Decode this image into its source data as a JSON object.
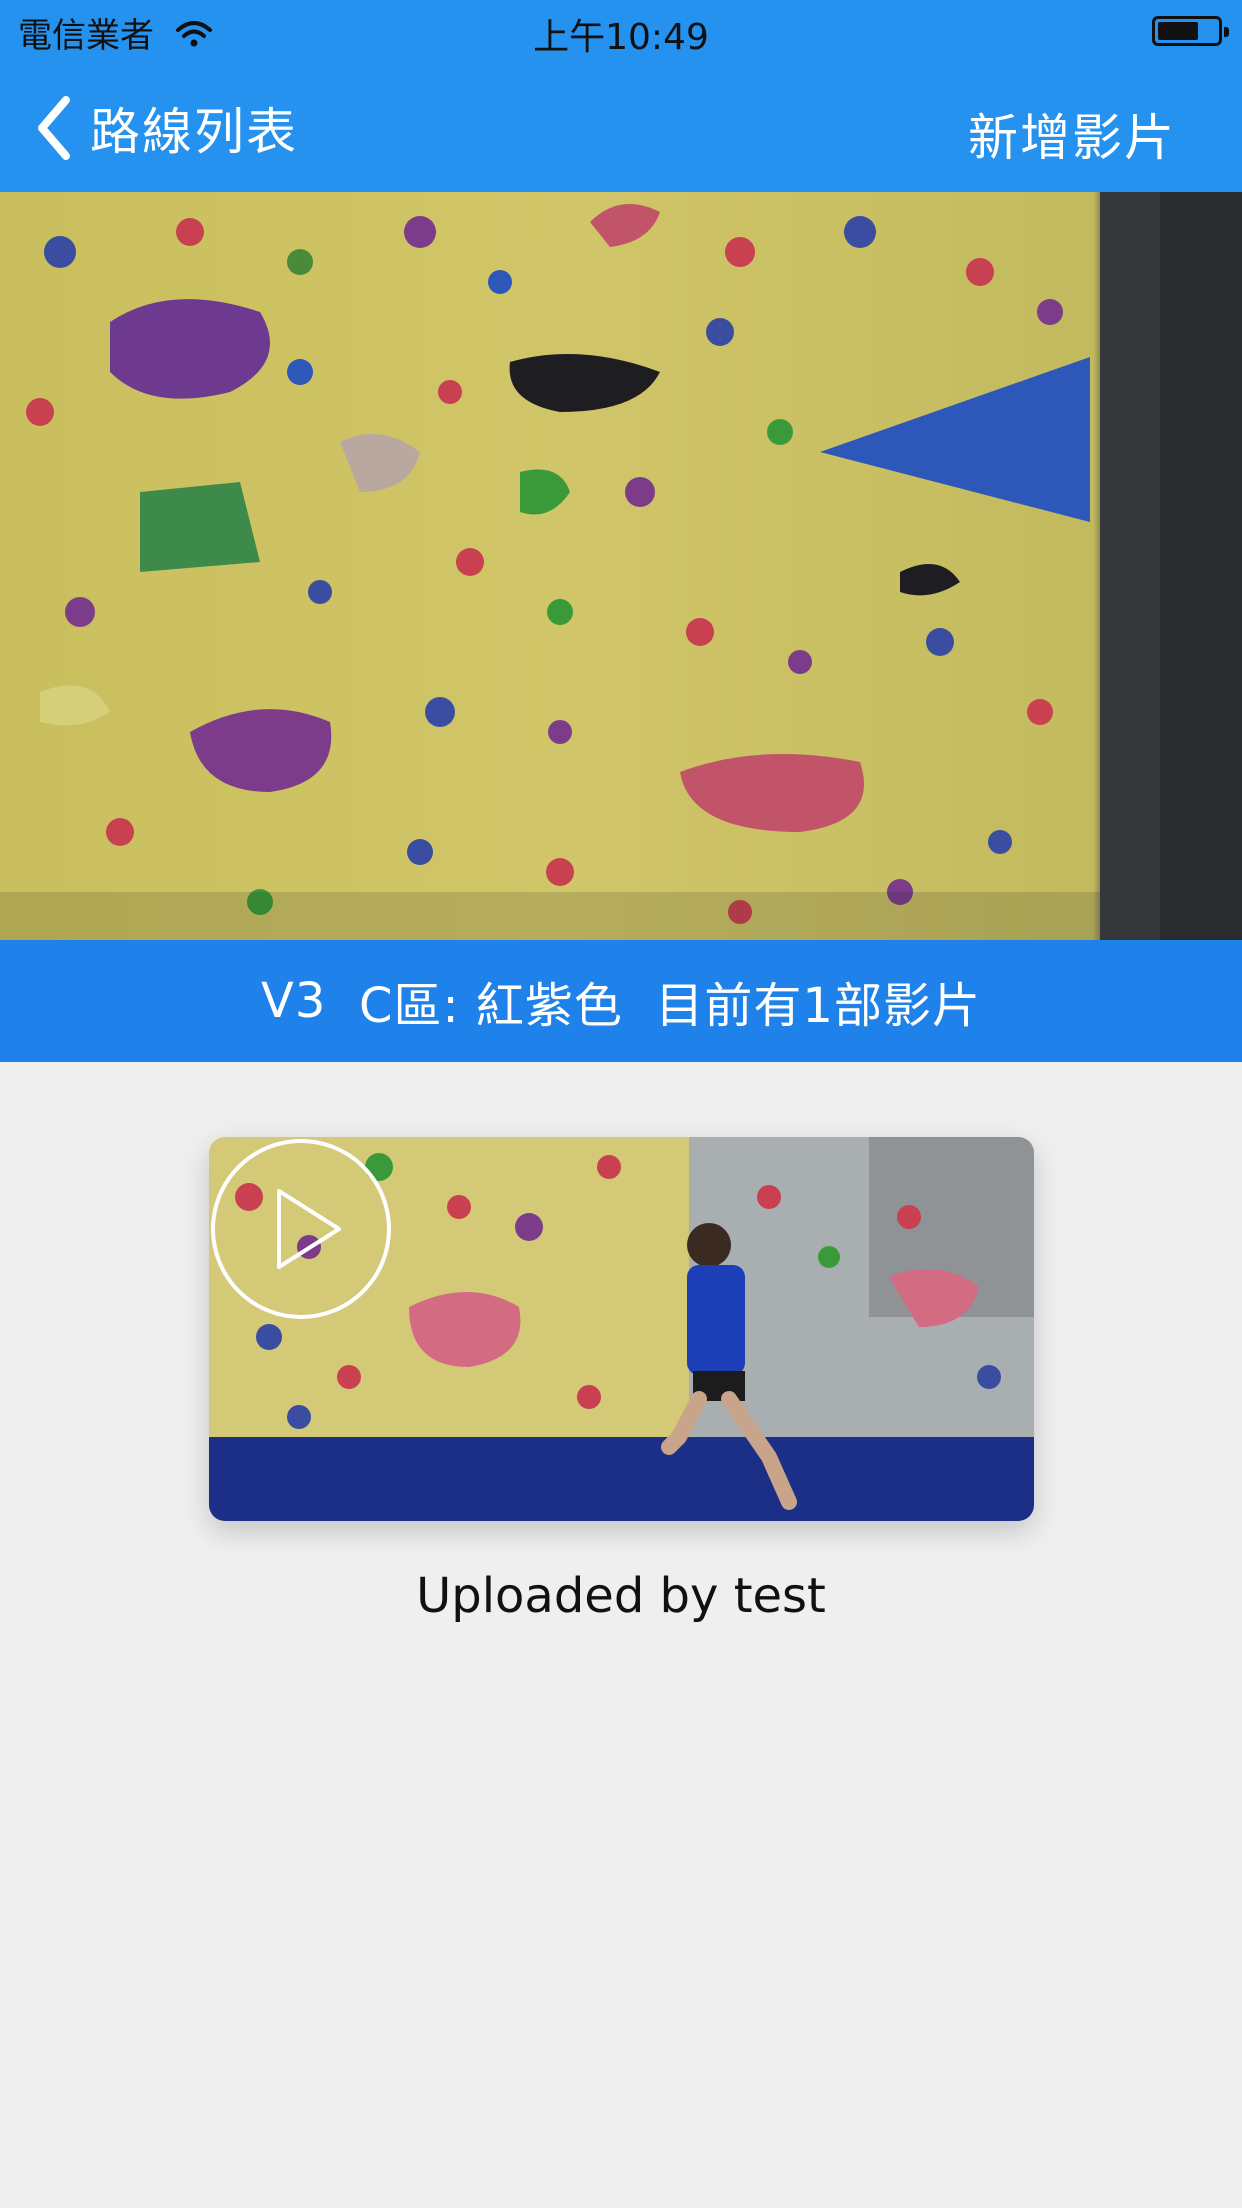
{
  "status_bar": {
    "carrier": "電信業者",
    "time": "上午10:49",
    "icons": [
      "wifi-icon",
      "battery-icon"
    ]
  },
  "nav": {
    "back_label": "路線列表",
    "back_icon": "chevron-left-icon",
    "action_label": "新增影片"
  },
  "route": {
    "grade": "V3",
    "area_color": "C區: 紅紫色",
    "video_count_text": "目前有1部影片"
  },
  "videos": [
    {
      "uploader_text": "Uploaded by test",
      "play_icon": "play-icon"
    }
  ],
  "colors": {
    "nav_blue": "#2592f0",
    "route_bar_blue": "#1f82ea",
    "background": "#efeff0"
  }
}
